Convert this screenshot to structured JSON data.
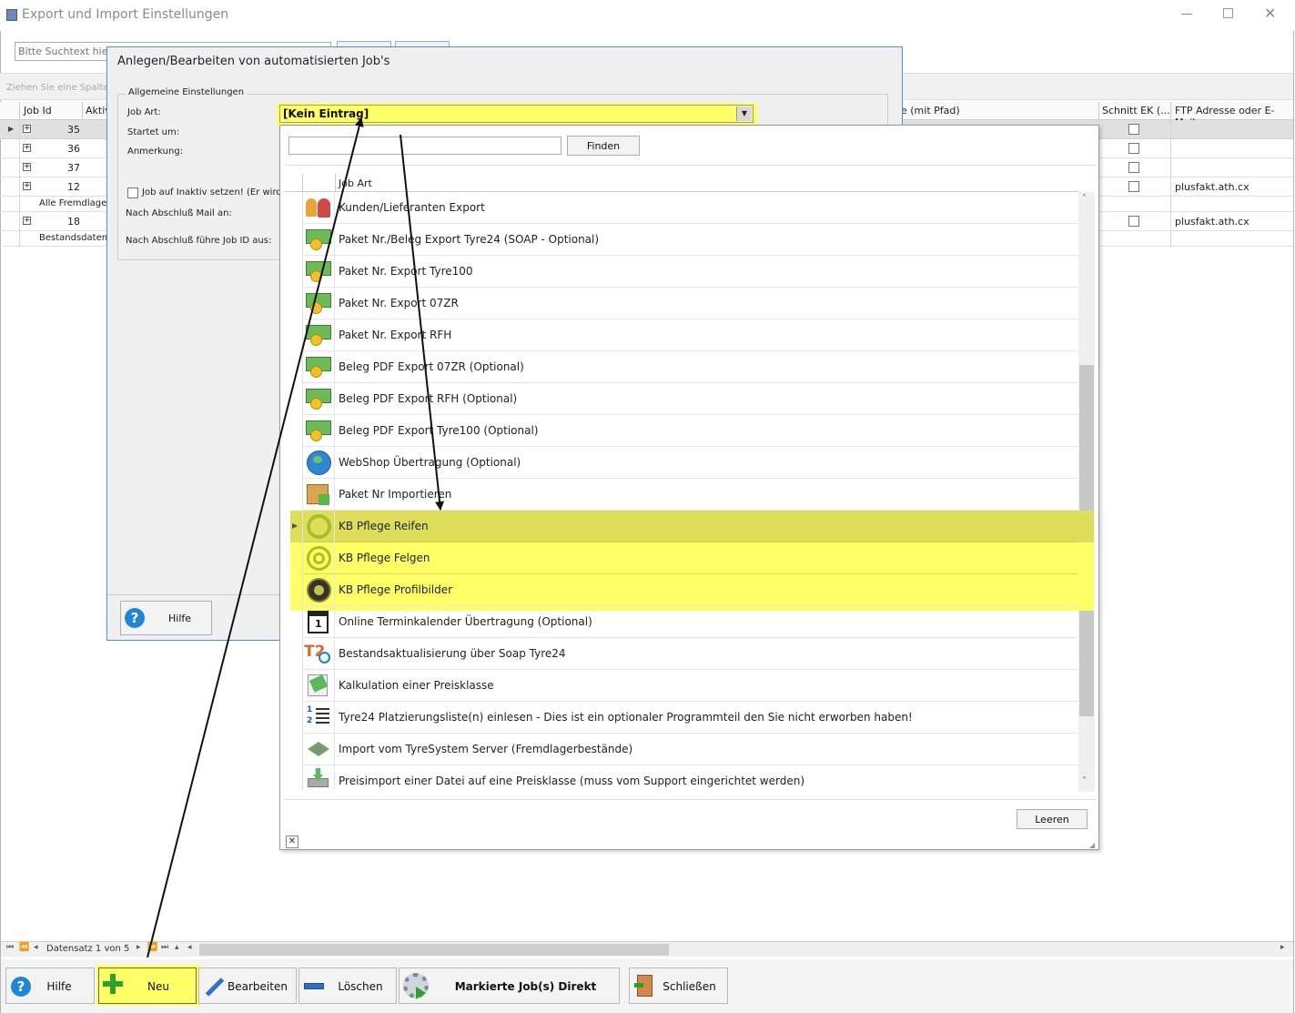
{
  "window": {
    "title": "Export und Import Einstellungen"
  },
  "search": {
    "placeholder": "Bitte Suchtext hier e"
  },
  "groupPanel": {
    "hint": "Ziehen Sie eine Spalten"
  },
  "grid": {
    "headers": {
      "job_id": "Job Id",
      "aktiv": "Aktiv",
      "pfad": "e (mit Pfad)",
      "schnitt": "Schnitt EK (...",
      "ftp": "FTP Adresse oder E-Mail"
    },
    "rows": [
      {
        "id": "35",
        "ftp": ""
      },
      {
        "id": "36",
        "ftp": ""
      },
      {
        "id": "37",
        "ftp": ""
      },
      {
        "id": "12",
        "ftp": "plusfakt.ath.cx"
      },
      {
        "group": "Alle Fremdlager"
      },
      {
        "id": "18",
        "ftp": "plusfakt.ath.cx"
      },
      {
        "group": "Bestandsdaten"
      }
    ]
  },
  "dialog": {
    "title": "Anlegen/Bearbeiten von automatisierten Job's",
    "group_title": "Allgemeine Einstellungen",
    "job_art_label": "Job Art:",
    "startet_label": "Startet um:",
    "anmerkung_label": "Anmerkung:",
    "inaktiv_label": "Job auf Inaktiv setzen! (Er wird",
    "mail_label": "Nach Abschluß Mail an:",
    "fuehre_label": "Nach Abschluß führe Job ID aus:",
    "combo_value": "[Kein Eintrag]",
    "help_button": "Hilfe"
  },
  "dropdown": {
    "find_button": "Finden",
    "column_header": "Job Art",
    "clear_button": "Leeren",
    "items": [
      {
        "label": "Kunden/Lieferanten Export",
        "icon": "people-icon"
      },
      {
        "label": "Paket Nr./Beleg Export Tyre24 (SOAP - Optional)",
        "icon": "money-icon"
      },
      {
        "label": "Paket Nr. Export Tyre100",
        "icon": "money-icon"
      },
      {
        "label": "Paket Nr. Export 07ZR",
        "icon": "money-icon"
      },
      {
        "label": "Paket Nr. Export RFH",
        "icon": "money-icon"
      },
      {
        "label": "Beleg PDF Export 07ZR (Optional)",
        "icon": "money-icon"
      },
      {
        "label": "Beleg PDF Export RFH (Optional)",
        "icon": "money-icon"
      },
      {
        "label": "Beleg PDF Export Tyre100 (Optional)",
        "icon": "money-icon"
      },
      {
        "label": "WebShop Übertragung (Optional)",
        "icon": "globe-icon"
      },
      {
        "label": "Paket Nr Importieren",
        "icon": "box-icon"
      },
      {
        "label": "KB Pflege Reifen",
        "icon": "tire-ring-icon"
      },
      {
        "label": "KB Pflege Felgen",
        "icon": "rim-icon"
      },
      {
        "label": "KB Pflege Profilbilder",
        "icon": "tread-icon"
      },
      {
        "label": "Online Terminkalender Übertragung (Optional)",
        "icon": "calendar-icon"
      },
      {
        "label": "Bestandsaktualisierung über Soap Tyre24",
        "icon": "t24-icon"
      },
      {
        "label": "Kalkulation einer Preisklasse",
        "icon": "calculation-icon"
      },
      {
        "label": "Tyre24 Platzierungsliste(n) einlesen - Dies ist ein optionaler Programmteil den Sie nicht erworben haben!",
        "icon": "numbered-list-icon"
      },
      {
        "label": "Import vom TyreSystem Server (Fremdlagerbestände)",
        "icon": "tyresystem-icon"
      },
      {
        "label": "Preisimport einer Datei auf eine Preisklasse (muss vom Support eingerichtet werden)",
        "icon": "download-icon"
      }
    ]
  },
  "navigator": {
    "record_text": "Datensatz 1 von 5"
  },
  "toolbar": {
    "hilfe": "Hilfe",
    "neu": "Neu",
    "bearbeiten": "Bearbeiten",
    "loeschen": "Löschen",
    "ausfuehren": "Markierte Job(s) Direkt ausführen",
    "schliessen": "Schließen"
  },
  "colors": {
    "highlight": "#ffff66",
    "selected_row": "#dede5a",
    "accent": "#3b8fd6"
  }
}
